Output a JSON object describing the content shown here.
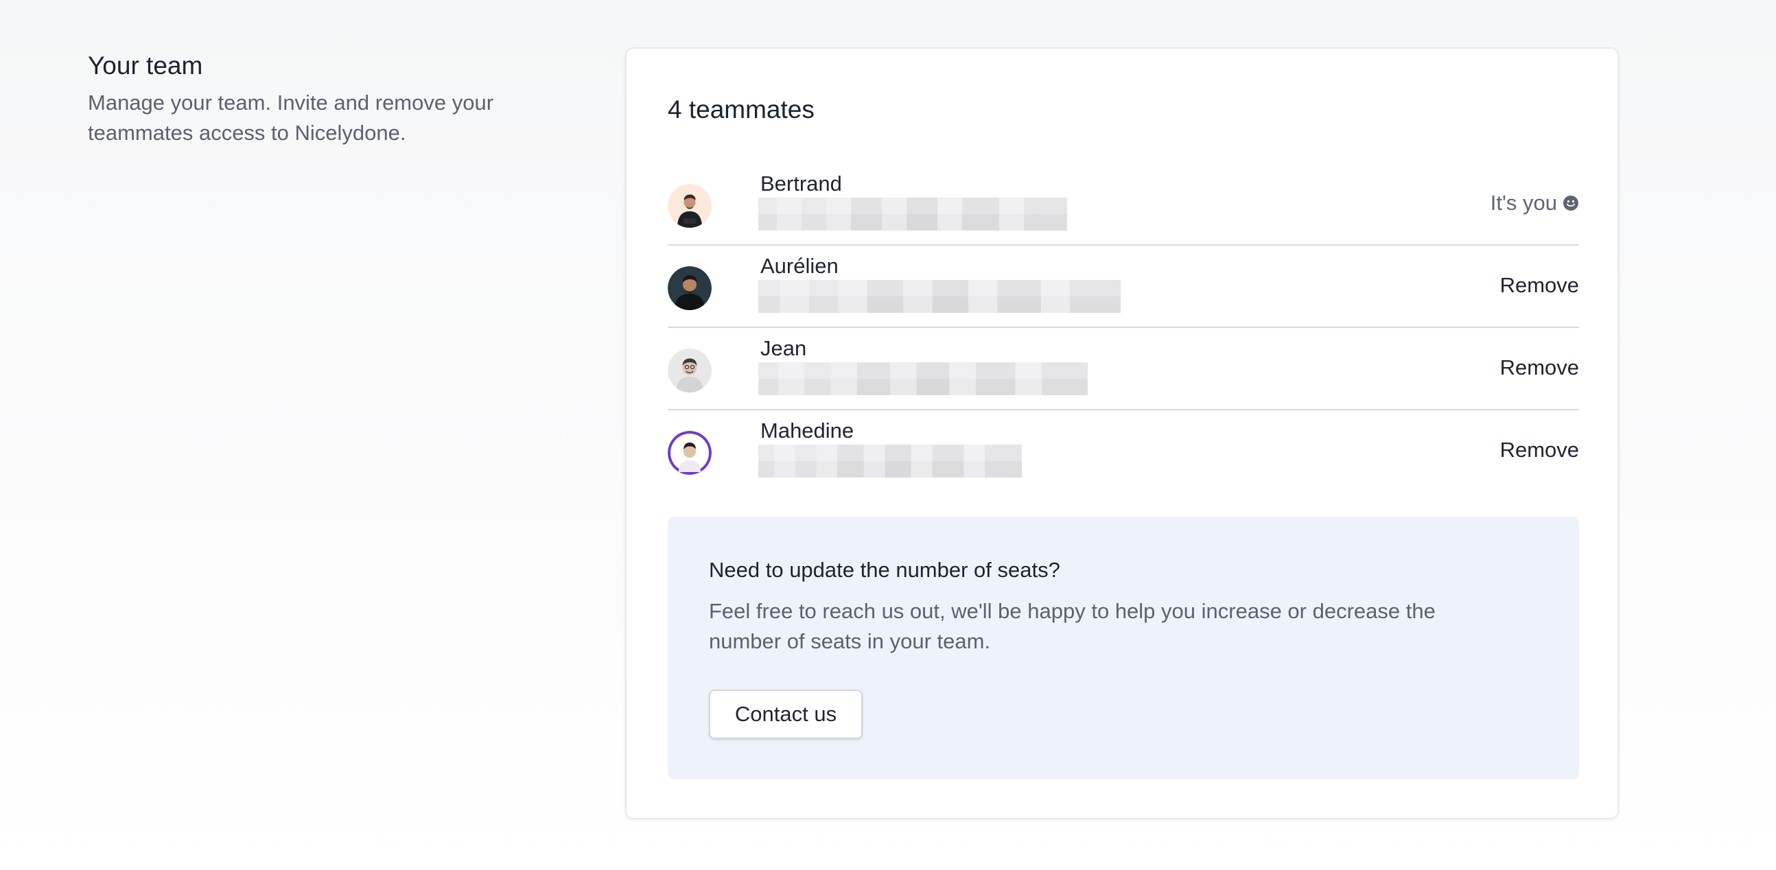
{
  "intro": {
    "title": "Your team",
    "description": "Manage your team. Invite and remove your teammates access to Nicelydone."
  },
  "card": {
    "title": "4 teammates"
  },
  "team": {
    "members": [
      {
        "name": "Bertrand",
        "email": "",
        "status": "It's you",
        "status_icon": "smile-icon",
        "avatar_bg": "#fde9dc"
      },
      {
        "name": "Aurélien",
        "email": "",
        "action": "Remove",
        "avatar_bg": "#2a3a44"
      },
      {
        "name": "Jean",
        "email": "",
        "action": "Remove",
        "avatar_bg": "#e8e8e8"
      },
      {
        "name": "Mahedine",
        "email": "",
        "action": "Remove",
        "avatar_bg": "#ffffff",
        "avatar_ring": "#6d3ad0"
      }
    ]
  },
  "seats": {
    "title": "Need to update the number of seats?",
    "body": "Feel free to reach us out, we'll be happy to help you increase or decrease the number of seats in your team.",
    "button_label": "Contact us"
  },
  "colors": {
    "panel_bg": "#eef3fb",
    "divider": "#d7d9dd",
    "muted_text": "#5b6170"
  }
}
